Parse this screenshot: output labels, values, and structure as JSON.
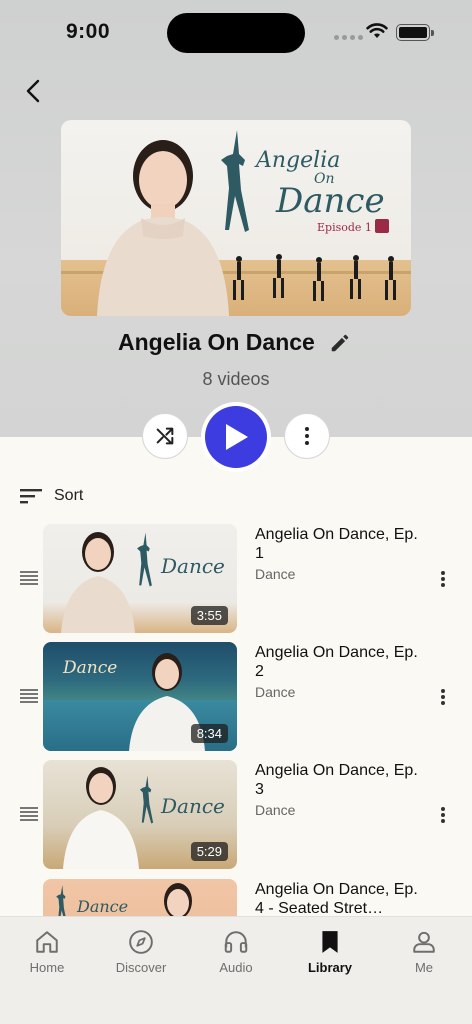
{
  "status_bar": {
    "time": "9:00"
  },
  "playlist": {
    "title": "Angelia On Dance",
    "count_label": "8 videos",
    "cover": {
      "title_line1": "Angelia",
      "title_line2": "On",
      "title_line3": "Dance",
      "episode": "Episode 1"
    }
  },
  "controls": {
    "sort_label": "Sort"
  },
  "videos": [
    {
      "title": "Angelia On Dance, Ep. 1",
      "category": "Dance",
      "duration": "3:55",
      "thumb_title": "Dance"
    },
    {
      "title": "Angelia On Dance, Ep. 2",
      "category": "Dance",
      "duration": "8:34",
      "thumb_title": "Dance"
    },
    {
      "title": "Angelia On Dance, Ep. 3",
      "category": "Dance",
      "duration": "5:29",
      "thumb_title": "Dance"
    },
    {
      "title": "Angelia On Dance, Ep. 4 - Seated Stret…",
      "category": "",
      "duration": "",
      "thumb_title": "Dance"
    }
  ],
  "tabs": [
    {
      "label": "Home",
      "icon": "home-icon"
    },
    {
      "label": "Discover",
      "icon": "compass-icon"
    },
    {
      "label": "Audio",
      "icon": "headphones-icon"
    },
    {
      "label": "Library",
      "icon": "bookmark-icon",
      "active": true
    },
    {
      "label": "Me",
      "icon": "user-icon"
    }
  ],
  "colors": {
    "accent": "#3c3ce0",
    "header_bg": "#d3d4d3",
    "page_bg": "#fbf9f4",
    "cover_title": "#2e5a63"
  }
}
